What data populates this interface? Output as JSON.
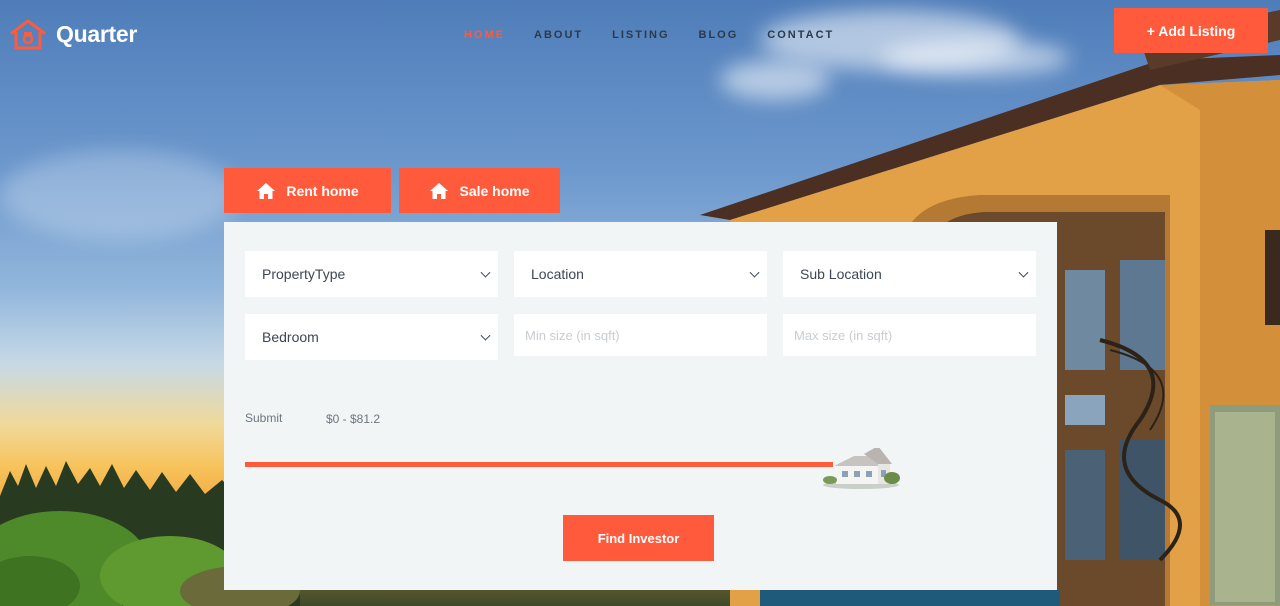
{
  "brand": {
    "name": "Quarter"
  },
  "nav": {
    "items": [
      {
        "label": "HOME",
        "active": true
      },
      {
        "label": "ABOUT",
        "active": false
      },
      {
        "label": "LISTING",
        "active": false
      },
      {
        "label": "BLOG",
        "active": false
      },
      {
        "label": "CONTACT",
        "active": false
      }
    ],
    "add_listing_label": "+ Add Listing"
  },
  "tabs": {
    "rent_label": "Rent home",
    "sale_label": "Sale home"
  },
  "search": {
    "property_type": "PropertyType",
    "location": "Location",
    "sub_location": "Sub Location",
    "bedroom": "Bedroom",
    "min_size_placeholder": "Min size (in sqft)",
    "max_size_placeholder": "Max size (in sqft)",
    "submit_label": "Submit",
    "price_range": "$0 - $81.2",
    "find_button": "Find Investor"
  },
  "colors": {
    "accent": "#ff5a3c",
    "panel_bg": "#f2f5f6",
    "nav_text": "#2b3a4a"
  }
}
